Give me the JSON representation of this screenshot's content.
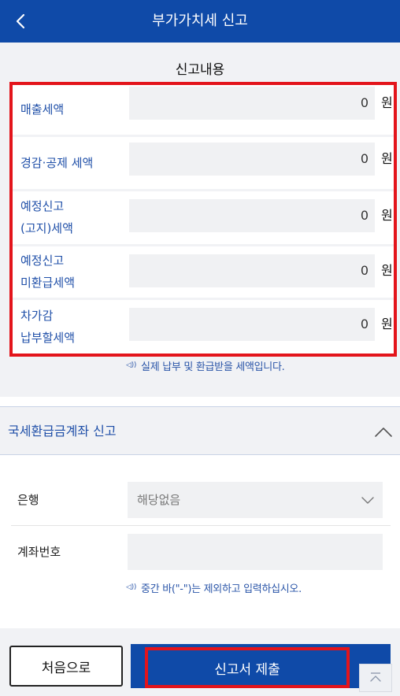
{
  "header": {
    "title": "부가가치세 신고",
    "back_icon": "chevron-left-icon"
  },
  "report": {
    "section_title": "신고내용",
    "rows": [
      {
        "label_lines": [
          "매출세액"
        ],
        "value": "0",
        "unit": "원"
      },
      {
        "label_lines": [
          "경감·공제 세액"
        ],
        "value": "0",
        "unit": "원"
      },
      {
        "label_lines": [
          "예정신고",
          "(고지)세액"
        ],
        "value": "0",
        "unit": "원"
      },
      {
        "label_lines": [
          "예정신고",
          "미환급세액"
        ],
        "value": "0",
        "unit": "원"
      },
      {
        "label_lines": [
          "차가감",
          "납부할세액"
        ],
        "value": "0",
        "unit": "원"
      }
    ],
    "note": "실제 납부 및 환급받을 세액입니다.",
    "note_icon": "speaker-icon"
  },
  "refund": {
    "title": "국세환급금계좌 신고",
    "collapse_icon": "chevron-up-icon",
    "bank_label": "은행",
    "bank_value": "해당없음",
    "bank_icon": "chevron-down-icon",
    "account_label": "계좌번호",
    "account_value": "",
    "account_note": "중간 바(\"-\")는 제외하고 입력하십시오."
  },
  "footer": {
    "first_button": "처음으로",
    "submit_button": "신고서 제출",
    "scroll_top_icon": "scroll-to-top-icon"
  },
  "colors": {
    "primary": "#0f4aa8",
    "highlight": "#e3141b",
    "label_blue": "#1f4fa8",
    "background": "#f1f2f5"
  }
}
